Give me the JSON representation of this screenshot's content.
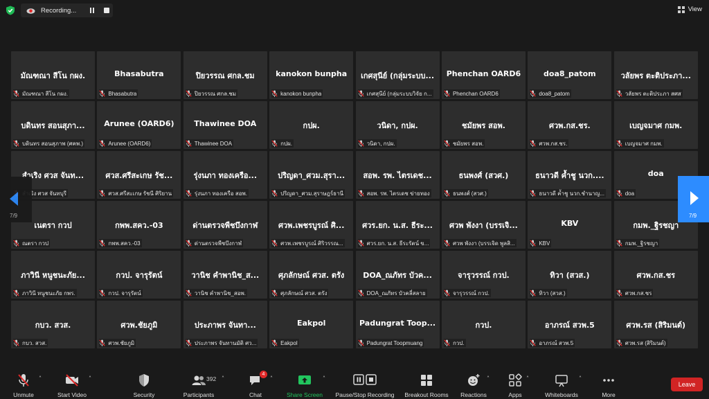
{
  "recording": {
    "label": "Recording..."
  },
  "view": {
    "label": "View"
  },
  "pagination": {
    "left": "7/9",
    "right": "7/9"
  },
  "colors": {
    "accent": "#2d8cff",
    "leave": "#d12424",
    "share": "#22c55e",
    "badge": "#e02828"
  },
  "participants": [
    {
      "name": "มัณฑณา สีโน กผง.",
      "label": "มัณฑณา สีโน กผง."
    },
    {
      "name": "Bhasabutra",
      "label": "Bhasabutra"
    },
    {
      "name": "ปิยวรรณ ศกล.ชม",
      "label": "ปิยวรรณ ศกล.ชม"
    },
    {
      "name": "kanokon bunpha",
      "label": "kanokon bunpha"
    },
    {
      "name": "เกศสุนีย์ (กลุ่มระบบ...",
      "label": "เกศสุนีย์ (กลุ่มระบบวิจัย ก..."
    },
    {
      "name": "Phenchan OARD6",
      "label": "Phenchan OARD6"
    },
    {
      "name": "doa8_patom",
      "label": "doa8_patom"
    },
    {
      "name": "วลัยพร ตะติประภา...",
      "label": "วลัยพร ตะติประภา สศส"
    },
    {
      "name": "บดินทร สอนสุภา...",
      "label": "บดินทร สอนสุภาพ (ศคพ.)"
    },
    {
      "name": "Arunee (OARD6)",
      "label": "Arunee (OARD6)"
    },
    {
      "name": "Thawinee DOA",
      "label": "Thawinee DOA"
    },
    {
      "name": "กปผ.",
      "label": "กปผ."
    },
    {
      "name": "วนิดา, กปผ.",
      "label": "วนิดา, กปผ."
    },
    {
      "name": "ชมัยพร สอพ.",
      "label": "ชมัยพร สอพ."
    },
    {
      "name": "ศวพ.กส.ชร.",
      "label": "ศวพ.กส.ชร."
    },
    {
      "name": "เบญจมาศ กมพ.",
      "label": "เบญจมาศ กมพ."
    },
    {
      "name": "สำเริง ศวส จันท...",
      "label": "สำเริง ศวส จันทบุรี"
    },
    {
      "name": "ศวส.ศรีสะเกษ รัช...",
      "label": "ศวส.ศรีสะเกษ รัชนี ศิริยาน"
    },
    {
      "name": "รุ่งนภา ทองเครือ...",
      "label": "รุ่งนภา ทองเครือ สอพ."
    },
    {
      "name": "ปริญดา_ศวม.สุรา...",
      "label": "ปริญดา_ศวม.สุราษฎร์ธานี"
    },
    {
      "name": "สอพ. รพ. ไตรเดช...",
      "label": "สอพ. รพ. ไตรเดช ข่ายทอง"
    },
    {
      "name": "ธนพงศ์ (สวศ.)",
      "label": "ธนพงศ์ (สวศ.)"
    },
    {
      "name": "ธนาวดี ค้ำชู นวก....",
      "label": "ธนาวดี ค้ำชู นวก.ชำนาญ..."
    },
    {
      "name": "doa",
      "label": "doa"
    },
    {
      "name": "เนตรา กวป",
      "label": "ณตรา กวป"
    },
    {
      "name": "กพพ.สคว.-03",
      "label": "กพพ.สคว.-03"
    },
    {
      "name": "ด่านตรวจพืชบึงกาฬ",
      "label": "ด่านตรวจพืชบึงกาฬ"
    },
    {
      "name": "ศวพ.เพชรบูรณ์ ศิ...",
      "label": "ศวพ.เพชรบูรณ์ ศิริวรรณ..."
    },
    {
      "name": "ศวร.ยก. น.ส. ธีระ...",
      "label": "ศวร.ยก. น.ส. ธีระรัตน์ ข..."
    },
    {
      "name": "ศวพ พังงา (บรรเจิ...",
      "label": "ศวพ พังงา (บรรเจิด พูลสิ..."
    },
    {
      "name": "KBV",
      "label": "KBV"
    },
    {
      "name": "กมพ._ฐิรชญา",
      "label": "กมพ._ฐิรชญา"
    },
    {
      "name": "ภาวินี หนูชนะภัย...",
      "label": "ภาวินี หนูชนะภัย กพร."
    },
    {
      "name": "กวป. จารุรัตน์",
      "label": "กวป. จารุรัตน์"
    },
    {
      "name": "วานิช คำพานิช_ส...",
      "label": "วานิช คำพานิช_สอพ."
    },
    {
      "name": "ศุภลักษณ์ ศวส. ตรัง",
      "label": "ศุภลักษณ์ ศวส. ตรัง"
    },
    {
      "name": "DOA_ณภัทร บัวค...",
      "label": "DOA_ณภัทร บัวคลี่สลาย"
    },
    {
      "name": "จารุวรรณ์ กวป.",
      "label": "จารุวรรณ์ กวป."
    },
    {
      "name": "ทิวา (สวส.)",
      "label": "ทิวา (สวส.)"
    },
    {
      "name": "ศวพ.กส.ชร",
      "label": "ศวพ.กส.ชร"
    },
    {
      "name": "กบว. สวส.",
      "label": "กบว. สวส."
    },
    {
      "name": "ศวพ.ชัยภูมิ",
      "label": "ศวพ.ชัยภูมิ"
    },
    {
      "name": "ประภาพร จันทา...",
      "label": "ประภาพร จันทานมัติ ศว..."
    },
    {
      "name": "Eakpol",
      "label": "Eakpol"
    },
    {
      "name": "Padungrat Toop...",
      "label": "Padungrat Toopmuang"
    },
    {
      "name": "กวป.",
      "label": "กวป."
    },
    {
      "name": "อาภรณ์ สวพ.5",
      "label": "อาภรณ์ สวพ.5"
    },
    {
      "name": "ศวพ.รส (สิริมนต์)",
      "label": "ศวพ.รส (สิริมนต์)"
    }
  ],
  "toolbar": {
    "unmute": "Unmute",
    "start_video": "Start Video",
    "security": "Security",
    "participants": "Participants",
    "participants_count": "392",
    "chat": "Chat",
    "chat_badge": "4",
    "share_screen": "Share Screen",
    "pause_stop": "Pause/Stop Recording",
    "breakout": "Breakout Rooms",
    "reactions": "Reactions",
    "apps": "Apps",
    "whiteboards": "Whiteboards",
    "more": "More",
    "leave": "Leave"
  }
}
